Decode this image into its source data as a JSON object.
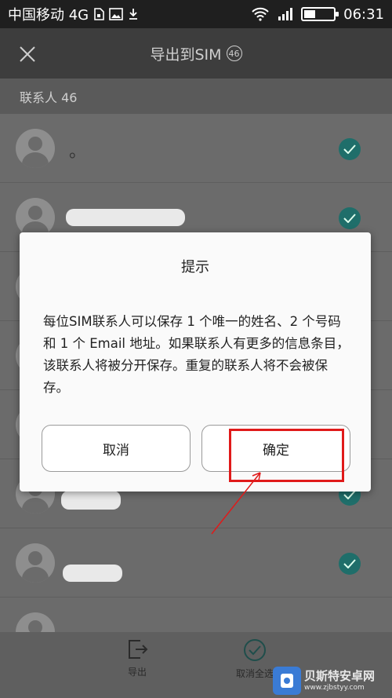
{
  "status_bar": {
    "carrier": "中国移动 4G",
    "time": "06:31"
  },
  "header": {
    "title": "导出到SIM",
    "count_badge": "46"
  },
  "section": {
    "label": "联系人 46"
  },
  "contacts": [
    {
      "name": "。"
    }
  ],
  "dialog": {
    "title": "提示",
    "message": "每位SIM联系人可以保存 1 个唯一的姓名、2 个号码和 1 个 Email 地址。如果联系人有更多的信息条目，该联系人将被分开保存。重复的联系人将不会被保存。",
    "cancel_label": "取消",
    "confirm_label": "确定"
  },
  "bottom_bar": {
    "export_label": "导出",
    "deselect_all_label": "取消全选"
  },
  "watermark": {
    "name": "贝斯特安卓网",
    "url": "www.zjbstyy.com"
  },
  "colors": {
    "check_teal": "#1f6e6a",
    "annotation_red": "#e01a1a"
  }
}
